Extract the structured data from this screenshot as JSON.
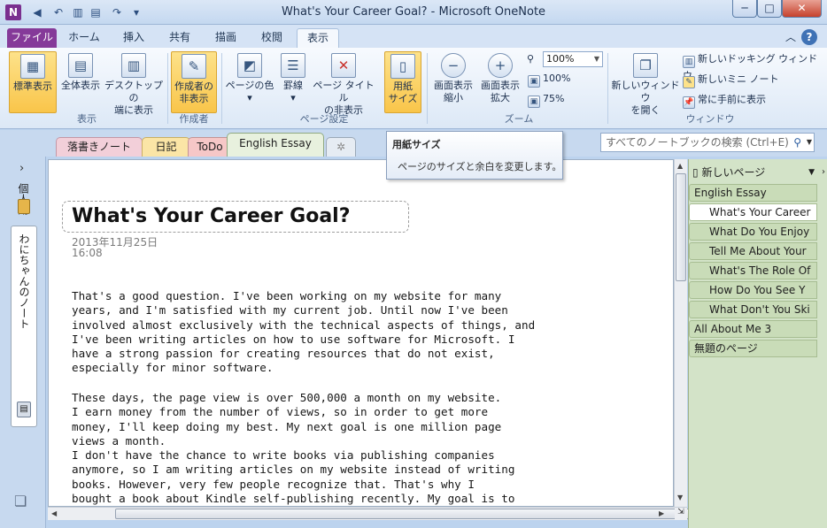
{
  "window": {
    "title": "What's Your Career Goal? - Microsoft OneNote",
    "app_icon": "N"
  },
  "quick_access": {
    "back": "◀",
    "undo": "↶",
    "redo": "↷",
    "dock": "▥",
    "page": "▤",
    "more": "▾"
  },
  "window_controls": {
    "minimize": "─",
    "maximize": "□",
    "close": "✕"
  },
  "ribbon_tabs": [
    "ファイル",
    "ホーム",
    "挿入",
    "共有",
    "描画",
    "校閲",
    "表示"
  ],
  "ribbon_right": {
    "collapse": "︿",
    "help": "?"
  },
  "ribbon": {
    "view_group": {
      "label": "表示",
      "normal": "標準表示",
      "full": "全体表示",
      "desktop_1": "デスクトップの",
      "desktop_2": "端に表示"
    },
    "author_group": {
      "label": "作成者",
      "hide_1": "作成者の",
      "hide_2": "非表示"
    },
    "page_setup_group": {
      "label": "ページ設定",
      "color": "ページの色",
      "rule": "罫線",
      "hide_title_1": "ページ タイトル",
      "hide_title_2": "の非表示",
      "paper_1": "用紙",
      "paper_2": "サイズ"
    },
    "zoom_group": {
      "label": "ズーム",
      "zoom_out_1": "画面表示",
      "zoom_out_2": "縮小",
      "zoom_in_1": "画面表示",
      "zoom_in_2": "拡大",
      "zoom_value": "100%",
      "z100": "100%",
      "z75": "75%"
    },
    "window_group": {
      "label": "ウィンドウ",
      "new_window_1": "新しいウィンドウ",
      "new_window_2": "を開く",
      "docking": "新しいドッキング ウィンドウ",
      "mini": "新しいミニ ノート",
      "on_top": "常に手前に表示"
    }
  },
  "tooltip": {
    "title": "用紙サイズ",
    "description": "ページのサイズと余白を変更します。"
  },
  "sections": [
    "落書きノート",
    "日記",
    "ToDo",
    "English Essay"
  ],
  "section_new": "✲",
  "search": {
    "placeholder": "すべてのノートブックの検索 (Ctrl+E)"
  },
  "left_nav": {
    "expand": "›",
    "personal": "個人用",
    "notebook": "わにちゃんのノート"
  },
  "page": {
    "title": "What's Your Career Goal?",
    "date": "2013年11月25日",
    "time": "16:08",
    "paragraph1": [
      "That's a good question. I've been working  on my website for many",
      "years, and I'm  satisfied with my  current job. Until now I've been",
      "involved  almost exclusively  with the technical aspects of things,  and",
      "I've been writing  articles on how  to use software for Microsoft. I",
      "have a strong passion for creating resources that do not exist,",
      "especially for minor  software."
    ],
    "paragraph2": [
      "These days, the page view is over 500,000  a month  on my  website.",
      "I earn money  from  the number  of views, so in order to get more",
      "money, I'll keep doing my  best. My next goal is one million  page",
      "views a month.",
      "I don't have the chance to write books  via publishing  companies",
      "anymore,  so I am  writing  articles on my website instead of writing",
      "books. However,  very few people recognize  that. That's why I",
      "bought a book about Kindle  self-publishing  recently. My goal is to"
    ]
  },
  "page_list": {
    "new_page": "新しいページ",
    "items": [
      {
        "label": "English Essay",
        "level": 0
      },
      {
        "label": "What's Your Career",
        "level": 1,
        "selected": true
      },
      {
        "label": "What Do You Enjoy",
        "level": 1
      },
      {
        "label": "Tell Me About Your",
        "level": 1
      },
      {
        "label": "What's The Role Of",
        "level": 1
      },
      {
        "label": "How Do You See Y",
        "level": 1
      },
      {
        "label": "What Don't You Ski",
        "level": 1
      },
      {
        "label": "All About Me 3",
        "level": 0
      },
      {
        "label": "無題のページ",
        "level": 0
      }
    ]
  },
  "colors": {
    "file_tab": "#853a99",
    "active_button": "#f9c54a",
    "section_english": "#e8f1de",
    "pages_bg": "#d3e3c8"
  }
}
